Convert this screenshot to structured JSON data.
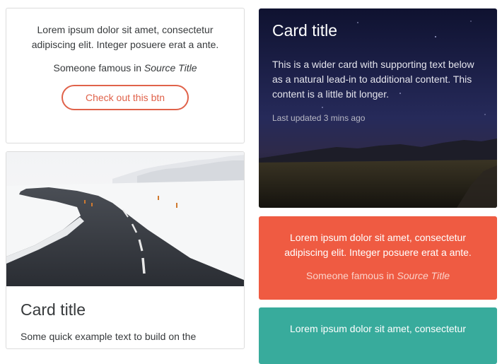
{
  "quote_card_white": {
    "quote": "Lorem ipsum dolor sit amet, consectetur adipiscing elit. Integer posuere erat a ante.",
    "footer_prefix": "Someone famous in ",
    "source": "Source Title",
    "button_label": "Check out this btn",
    "accent_color": "#e0624a"
  },
  "image_card": {
    "title": "Card title",
    "text": "Some quick example text to build on the"
  },
  "night_card": {
    "title": "Card title",
    "text": "This is a wider card with supporting text below as a natural lead-in to additional content. This content is a little bit longer.",
    "meta": "Last updated 3 mins ago"
  },
  "quote_card_red": {
    "quote": "Lorem ipsum dolor sit amet, consectetur adipiscing elit. Integer posuere erat a ante.",
    "footer_prefix": "Someone famous in ",
    "source": "Source Title",
    "bg_color": "#ef5b42"
  },
  "quote_card_teal": {
    "quote": "Lorem ipsum dolor sit amet, consectetur",
    "bg_color": "#38ab9c"
  }
}
